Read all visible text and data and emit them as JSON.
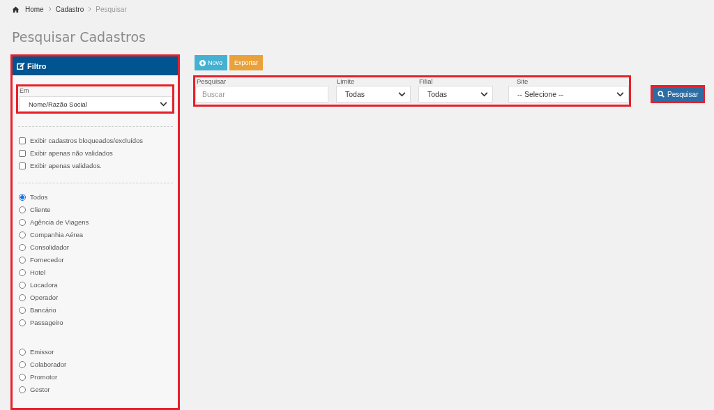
{
  "breadcrumb": [
    {
      "label": "Home",
      "kind": "link"
    },
    {
      "label": "Cadastro",
      "kind": "link"
    },
    {
      "label": "Pesquisar",
      "kind": "current"
    }
  ],
  "title": "Pesquisar Cadastros",
  "filter": {
    "title": "Filtro",
    "field": {
      "label": "Em",
      "value": "Nome/Razão Social"
    },
    "checkboxes": [
      {
        "label": "Exibir cadastros bloqueados/excluídos",
        "checked": false
      },
      {
        "label": "Exibir apenas não validados",
        "checked": false
      },
      {
        "label": "Exibir apenas validados.",
        "checked": false
      }
    ],
    "types": [
      {
        "label": "Todos",
        "selected": true
      },
      {
        "label": "Cliente",
        "selected": false
      },
      {
        "label": "Agência de Viagens",
        "selected": false
      },
      {
        "label": "Companhia Aérea",
        "selected": false
      },
      {
        "label": "Consolidador",
        "selected": false
      },
      {
        "label": "Fornecedor",
        "selected": false
      },
      {
        "label": "Hotel",
        "selected": false
      },
      {
        "label": "Locadora",
        "selected": false
      },
      {
        "label": "Operador",
        "selected": false
      },
      {
        "label": "Bancário",
        "selected": false
      },
      {
        "label": "Passageiro",
        "selected": false
      }
    ],
    "roles": [
      {
        "label": "Emissor",
        "selected": false
      },
      {
        "label": "Colaborador",
        "selected": false
      },
      {
        "label": "Promotor",
        "selected": false
      },
      {
        "label": "Gestor",
        "selected": false
      }
    ]
  },
  "actions": [
    {
      "label": "Novo",
      "kind": "new"
    },
    {
      "label": "Exportar",
      "kind": "export"
    }
  ],
  "search_fields": [
    {
      "label": "Pesquisar",
      "kind": "text",
      "placeholder": "Buscar"
    },
    {
      "label": "Limite",
      "kind": "select",
      "value": "Todas"
    },
    {
      "label": "Filial",
      "kind": "select",
      "value": "Todas"
    },
    {
      "label": "Site",
      "kind": "select",
      "value": "-- Selecione --"
    }
  ],
  "search_button": "Pesquisar"
}
